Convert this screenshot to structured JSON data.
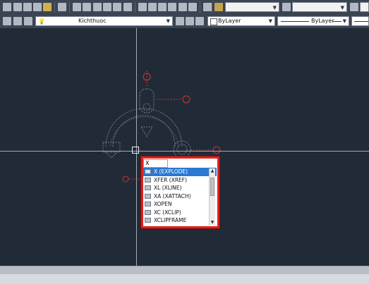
{
  "layer_combo": {
    "value": "Kichthuoc"
  },
  "properties": {
    "color_value": "ByLayer",
    "linetype_value": "ByLayer"
  },
  "command_popup": {
    "input_value": "X",
    "suggestions": [
      {
        "label": "X (EXPLODE)",
        "icon": "explode-icon",
        "selected": true
      },
      {
        "label": "XFER (XREF)",
        "icon": "xref-icon",
        "selected": false
      },
      {
        "label": "XL (XLINE)",
        "icon": "xline-icon",
        "selected": false
      },
      {
        "label": "XA (XATTACH)",
        "icon": "xattach-icon",
        "selected": false
      },
      {
        "label": "XOPEN",
        "icon": "xopen-icon",
        "selected": false
      },
      {
        "label": "XC (XCLIP)",
        "icon": "xclip-icon",
        "selected": false
      },
      {
        "label": "XCLIPFRAME",
        "icon": "xclipframe-icon",
        "selected": false
      }
    ]
  },
  "colors": {
    "canvas_bg": "#212a37",
    "highlight_border": "#e0201c",
    "selection_blue": "#2a78d2",
    "marker_red": "#d63131"
  }
}
